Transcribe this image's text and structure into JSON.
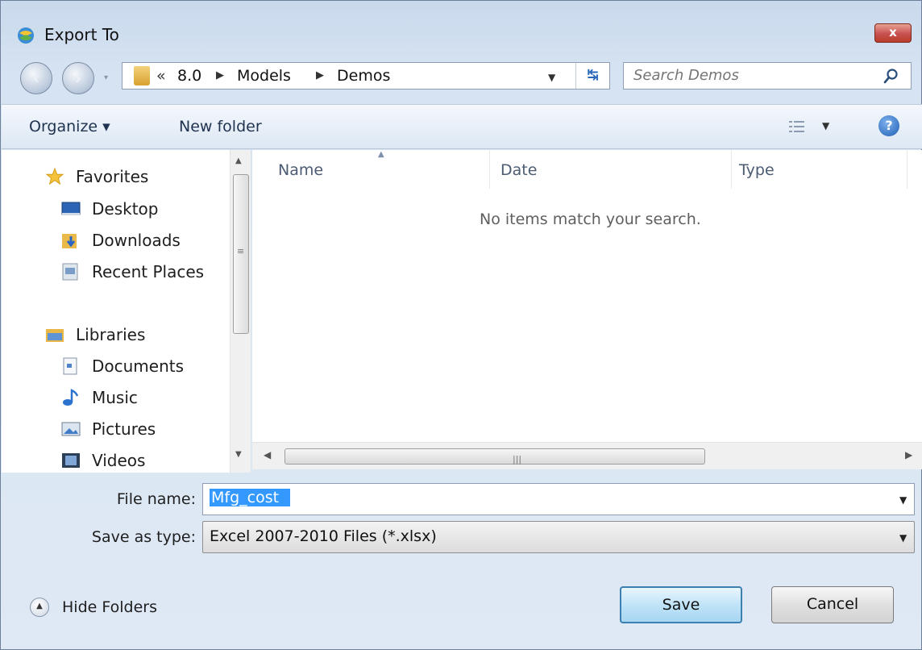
{
  "window": {
    "title": "Export To",
    "close_label": "x"
  },
  "address_bar": {
    "overflow": "«",
    "breadcrumbs": [
      "8.0",
      "Models",
      "Demos"
    ]
  },
  "search": {
    "placeholder": "Search Demos"
  },
  "toolbar": {
    "organize_label": "Organize ▾",
    "new_folder_label": "New folder",
    "help_label": "?"
  },
  "nav_pane": {
    "items": [
      {
        "label": "Favorites",
        "icon": "star-icon"
      },
      {
        "label": "Desktop",
        "icon": "desktop-icon"
      },
      {
        "label": "Downloads",
        "icon": "downloads-icon"
      },
      {
        "label": "Recent Places",
        "icon": "recent-places-icon"
      },
      {
        "label": "Libraries",
        "icon": "libraries-icon"
      },
      {
        "label": "Documents",
        "icon": "documents-icon"
      },
      {
        "label": "Music",
        "icon": "music-icon"
      },
      {
        "label": "Pictures",
        "icon": "pictures-icon"
      },
      {
        "label": "Videos",
        "icon": "videos-icon"
      }
    ]
  },
  "file_list": {
    "columns": [
      "Name",
      "Date",
      "Type"
    ],
    "empty_message": "No items match your search."
  },
  "form": {
    "file_name_label": "File name:",
    "file_name_value": "Mfg_cost",
    "save_type_label": "Save as type:",
    "save_type_value": "Excel 2007-2010 Files (*.xlsx)"
  },
  "footer": {
    "hide_folders_label": "Hide Folders",
    "save_label": "Save",
    "cancel_label": "Cancel"
  },
  "colors": {
    "selection": "#3399ff",
    "window_frame": "#d6e3f2",
    "close_button": "#c75050"
  }
}
